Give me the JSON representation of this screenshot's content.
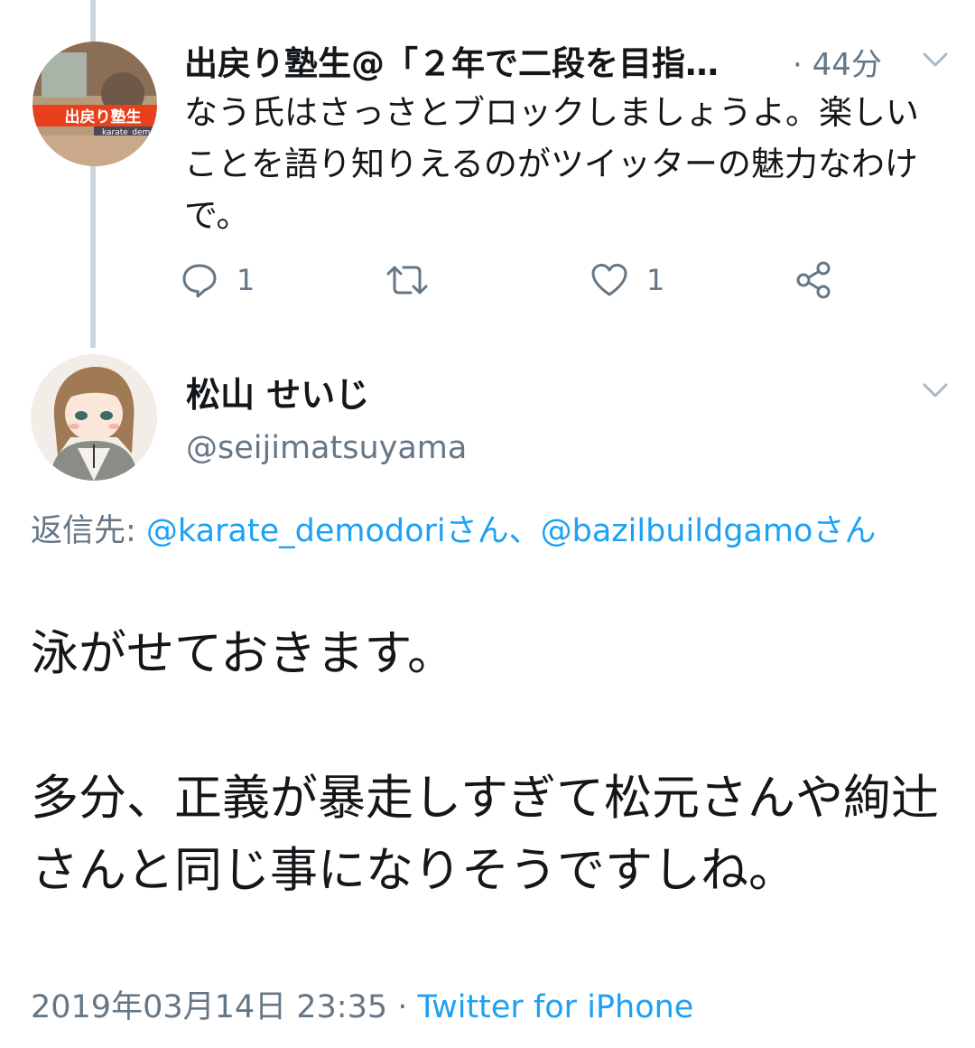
{
  "tweet1": {
    "author_name": "出戻り塾生@「２年で二段を目指…",
    "time": "· 44分",
    "avatar_text": "出戻り塾生",
    "avatar_subtext": "karate_demodo",
    "text": "なう氏はさっさとブロックしましょうよ。楽しいことを語り知りえるのがツイッターの魅力なわけで。",
    "reply_count": "1",
    "like_count": "1"
  },
  "tweet2": {
    "author_name": "松山 せいじ",
    "handle": "@seijimatsuyama",
    "reply_prefix": "返信先: ",
    "reply_mention1": "@karate_demodoriさん",
    "reply_separator": "、",
    "reply_mention2": "@bazilbuildgamoさん",
    "body_line1": "泳がせておきます。",
    "body_line2": "多分、正義が暴走しすぎて松元さんや絢辻さんと同じ事になりそうですしね。",
    "date": "2019年03月14日 23:35 · ",
    "source": "Twitter for iPhone"
  },
  "colors": {
    "accent": "#1da1f2",
    "secondary_text": "#657786",
    "thread_line": "#ccd6dd"
  },
  "icons": [
    "chevron-down-icon",
    "reply-icon",
    "retweet-icon",
    "heart-icon",
    "share-icon"
  ]
}
